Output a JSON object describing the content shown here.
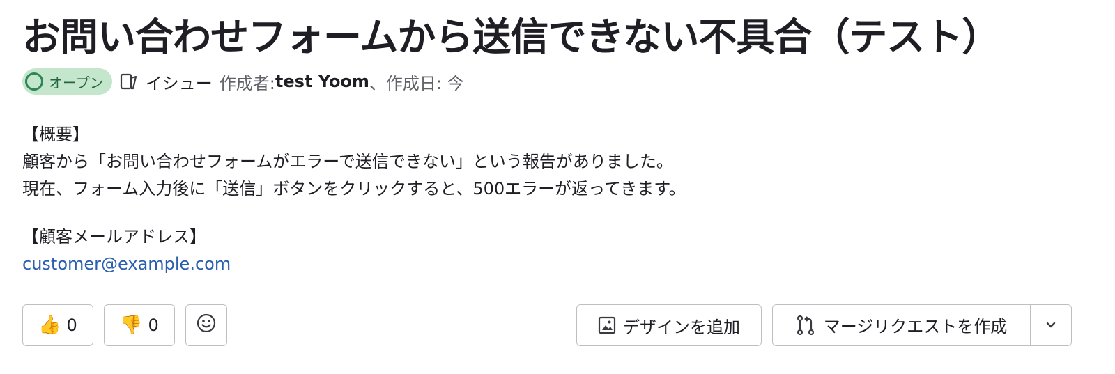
{
  "issue": {
    "title": "お問い合わせフォームから送信できない不具合（テスト）",
    "status": "オープン",
    "type": "イシュー",
    "author_label": "作成者: ",
    "author": "test Yoom",
    "created_label": "、作成日: 今"
  },
  "description": {
    "section1_heading": "【概要】",
    "section1_line1": "顧客から「お問い合わせフォームがエラーで送信できない」という報告がありました。",
    "section1_line2": "現在、フォーム入力後に「送信」ボタンをクリックすると、500エラーが返ってきます。",
    "section2_heading": "【顧客メールアドレス】",
    "email": "customer@example.com"
  },
  "reactions": {
    "thumbs_up_count": "0",
    "thumbs_down_count": "0"
  },
  "actions": {
    "add_design_label": "デザインを追加",
    "create_mr_label": "マージリクエストを作成"
  },
  "colors": {
    "status_bg": "#c3e6cd",
    "status_text": "#24663b",
    "link": "#2a5fb0"
  }
}
